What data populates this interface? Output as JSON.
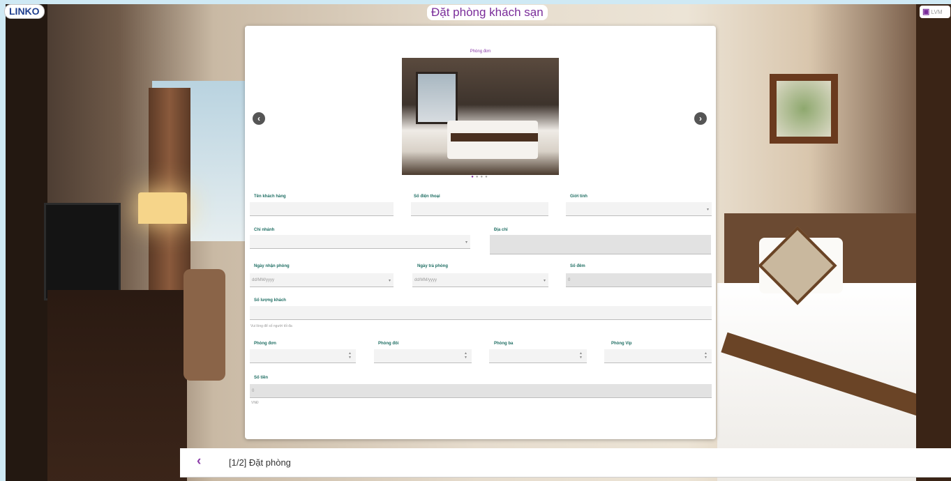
{
  "app": {
    "logo": "LINKO",
    "title": "Đặt phòng khách sạn",
    "user_chip": "LVM"
  },
  "colors": {
    "accent": "#7a2c9a",
    "label": "#1f6e63"
  },
  "carousel": {
    "caption": "Phòng đơn",
    "slide_count": 4,
    "active_slide": 1,
    "prev_icon": "chevron-left-icon",
    "next_icon": "chevron-right-icon"
  },
  "form": {
    "customer_name": {
      "label": "Tên khách hàng",
      "value": ""
    },
    "phone": {
      "label": "Số điện thoại",
      "value": ""
    },
    "gender": {
      "label": "Giới tính",
      "value": ""
    },
    "branch": {
      "label": "Chi nhánh",
      "value": ""
    },
    "address": {
      "label": "Địa chỉ",
      "value": ""
    },
    "checkin": {
      "label": "Ngày nhận phòng",
      "value": "dd/MM/yyyy"
    },
    "checkout": {
      "label": "Ngày trả phòng",
      "value": "dd/MM/yyyy"
    },
    "nights": {
      "label": "Số đêm",
      "value": "0"
    },
    "guests": {
      "label": "Số lượng khách",
      "value": "",
      "hint": "Vui lòng để số người tối đa"
    },
    "single": {
      "label": "Phòng đơn",
      "value": ""
    },
    "double": {
      "label": "Phòng đôi",
      "value": ""
    },
    "triple": {
      "label": "Phòng ba",
      "value": ""
    },
    "vip": {
      "label": "Phòng Vip",
      "value": ""
    },
    "total": {
      "label": "Số tiền",
      "value": "0",
      "unit": "VNĐ"
    }
  },
  "footer": {
    "step_label": "[1/2] Đặt phòng",
    "back_icon": "chevron-left-icon"
  }
}
